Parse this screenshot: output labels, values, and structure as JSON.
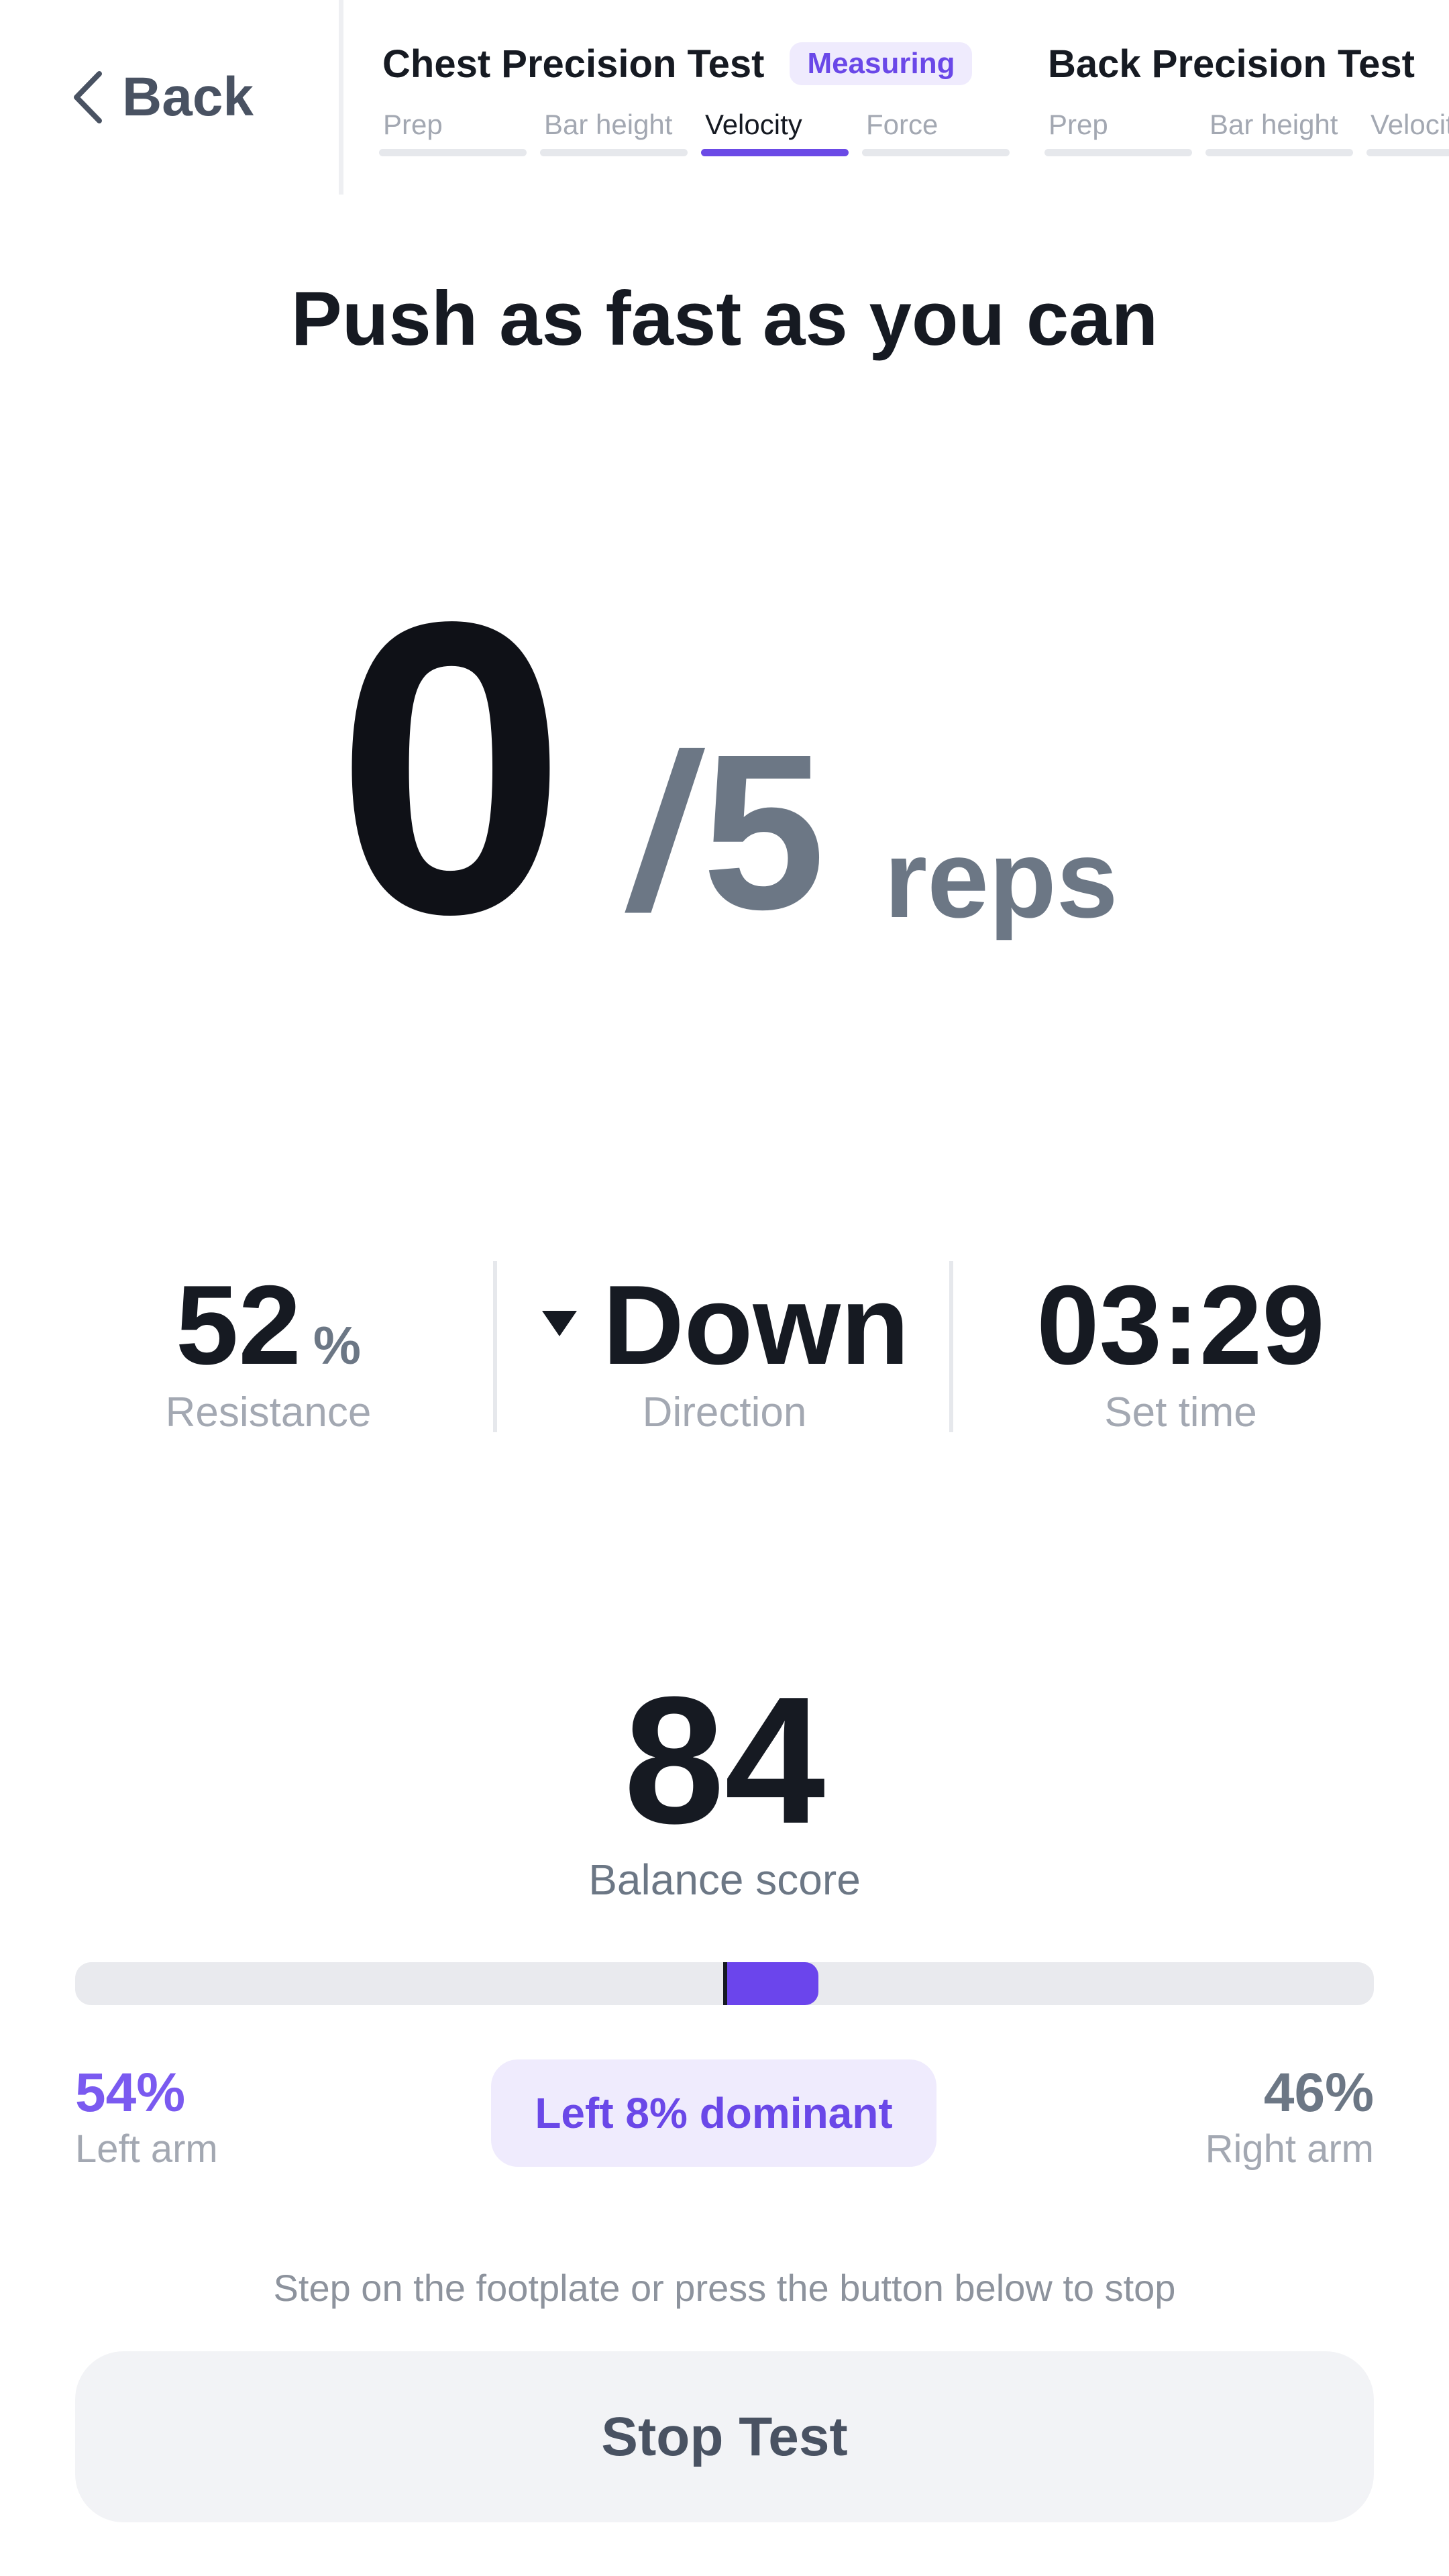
{
  "header": {
    "back_label": "Back",
    "tests": [
      {
        "title": "Chest Precision Test",
        "badge": "Measuring",
        "steps": [
          {
            "label": "Prep",
            "active": false
          },
          {
            "label": "Bar height",
            "active": false
          },
          {
            "label": "Velocity",
            "active": true
          },
          {
            "label": "Force",
            "active": false
          }
        ]
      },
      {
        "title": "Back Precision Test",
        "steps": [
          {
            "label": "Prep",
            "active": false
          },
          {
            "label": "Bar height",
            "active": false
          },
          {
            "label": "Velocity",
            "active": false
          }
        ]
      }
    ]
  },
  "instruction": "Push as fast as you can",
  "reps": {
    "current": "0",
    "total": "5",
    "slash": "/",
    "unit": "reps"
  },
  "stats": {
    "resistance": {
      "value": "52",
      "unit": "%",
      "label": "Resistance"
    },
    "direction": {
      "value": "Down",
      "label": "Direction",
      "icon": "triangle-down-icon"
    },
    "set_time": {
      "value": "03:29",
      "label": "Set time"
    }
  },
  "balance": {
    "score": "84",
    "label": "Balance score",
    "left_pct": "54%",
    "left_label": "Left arm",
    "right_pct": "46%",
    "right_label": "Right arm",
    "dominance": "Left 8% dominant",
    "dominance_fraction": 0.08
  },
  "footer": {
    "hint": "Step on the footplate or press the button below to stop",
    "stop_label": "Stop Test"
  },
  "colors": {
    "accent": "#6b45ec",
    "accent_soft": "#efebfd",
    "text_primary": "#161a22",
    "text_muted": "#a3a8b2",
    "text_secondary": "#6c7785"
  }
}
